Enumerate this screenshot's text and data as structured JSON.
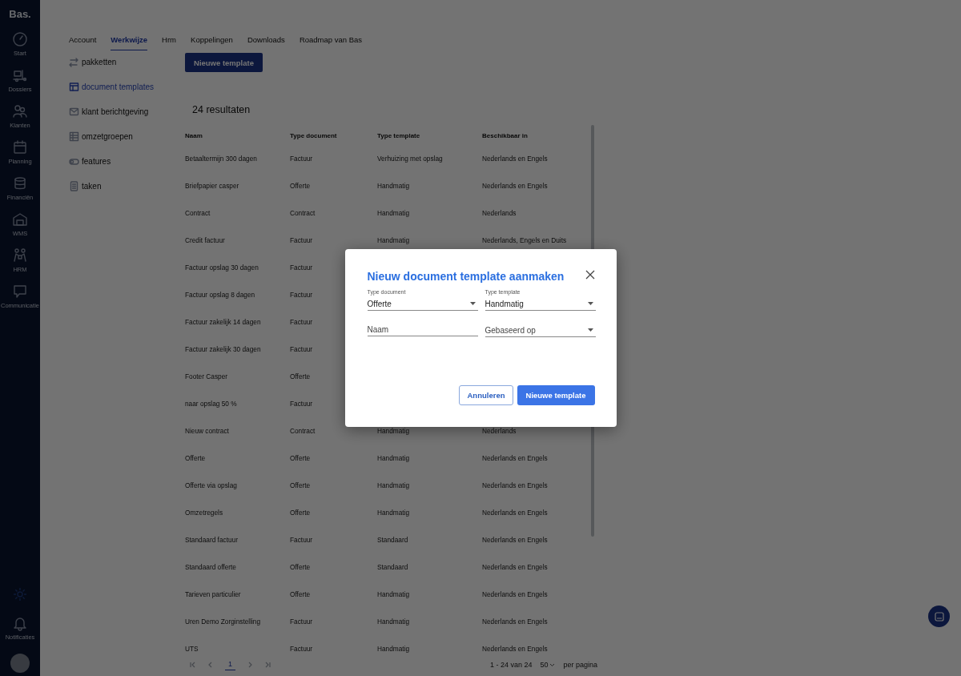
{
  "sidebar": {
    "logo": "Bas.",
    "items": [
      {
        "label": "Start"
      },
      {
        "label": "Dossiers"
      },
      {
        "label": "Klanten"
      },
      {
        "label": "Planning"
      },
      {
        "label": "Financiën"
      },
      {
        "label": "WMS"
      },
      {
        "label": "HRM"
      },
      {
        "label": "Communicatie"
      }
    ],
    "bottom_items": [
      {
        "label": "Notificaties"
      }
    ]
  },
  "tabs": [
    {
      "label": "Account",
      "selected": false
    },
    {
      "label": "Werkwijze",
      "selected": true
    },
    {
      "label": "Hrm",
      "selected": false
    },
    {
      "label": "Koppelingen",
      "selected": false
    },
    {
      "label": "Downloads",
      "selected": false
    },
    {
      "label": "Roadmap van Bas",
      "selected": false
    }
  ],
  "subnav": [
    {
      "label": "pakketten",
      "selected": false
    },
    {
      "label": "document templates",
      "selected": true
    },
    {
      "label": "klant berichtgeving",
      "selected": false
    },
    {
      "label": "omzetgroepen",
      "selected": false
    },
    {
      "label": "features",
      "selected": false
    },
    {
      "label": "taken",
      "selected": false
    }
  ],
  "new_button": "Nieuwe template",
  "result_count": "24 resultaten",
  "table": {
    "columns": [
      "Naam",
      "Type document",
      "Type template",
      "Beschikbaar in"
    ],
    "rows": [
      [
        "Betaaltermijn 300 dagen",
        "Factuur",
        "Verhuizing met opslag",
        "Nederlands en Engels"
      ],
      [
        "Briefpapier casper",
        "Offerte",
        "Handmatig",
        "Nederlands en Engels"
      ],
      [
        "Contract",
        "Contract",
        "Handmatig",
        "Nederlands"
      ],
      [
        "Credit factuur",
        "Factuur",
        "Handmatig",
        "Nederlands, Engels en Duits"
      ],
      [
        "Factuur opslag 30 dagen",
        "Factuur"
      ],
      [
        "Factuur opslag 8 dagen",
        "Factuur"
      ],
      [
        "Factuur zakelijk 14 dagen",
        "Factuur"
      ],
      [
        "Factuur zakelijk 30 dagen",
        "Factuur"
      ],
      [
        "Footer Casper",
        "Offerte"
      ],
      [
        "naar opslag 50 %",
        "Factuur"
      ],
      [
        "Nieuw contract",
        "Contract",
        "Handmatig",
        "Nederlands"
      ],
      [
        "Offerte",
        "Offerte",
        "Handmatig",
        "Nederlands en Engels"
      ],
      [
        "Offerte via opslag",
        "Offerte",
        "Handmatig",
        "Nederlands en Engels"
      ],
      [
        "Omzetregels",
        "Offerte",
        "Handmatig",
        "Nederlands en Engels"
      ],
      [
        "Standaard factuur",
        "Factuur",
        "Standaard",
        "Nederlands en Engels"
      ],
      [
        "Standaard offerte",
        "Offerte",
        "Standaard",
        "Nederlands en Engels"
      ],
      [
        "Tarieven particulier",
        "Offerte",
        "Handmatig",
        "Nederlands en Engels"
      ],
      [
        "Uren Demo Zorginstelling",
        "Factuur",
        "Handmatig",
        "Nederlands en Engels"
      ],
      [
        "UTS",
        "Factuur",
        "Handmatig",
        "Nederlands en Engels"
      ]
    ]
  },
  "pagination": {
    "pages": [
      {
        "label": "1",
        "selected": true
      }
    ],
    "range": "1 - 24 van 24",
    "per_page": "50",
    "per_page_label": "per pagina"
  },
  "modal": {
    "title": "Nieuw document template aanmaken",
    "fields": [
      {
        "kind": "select",
        "label": "Type document",
        "value": "Offerte"
      },
      {
        "kind": "select",
        "label": "Type template",
        "value": "Handmatig"
      },
      {
        "kind": "input",
        "placeholder": "Naam"
      },
      {
        "kind": "select",
        "placeholder": "Gebaseerd op"
      }
    ],
    "buttons": [
      {
        "label": "Annuleren",
        "kind": "secondary"
      },
      {
        "label": "Nieuwe template",
        "kind": "primary"
      }
    ]
  }
}
